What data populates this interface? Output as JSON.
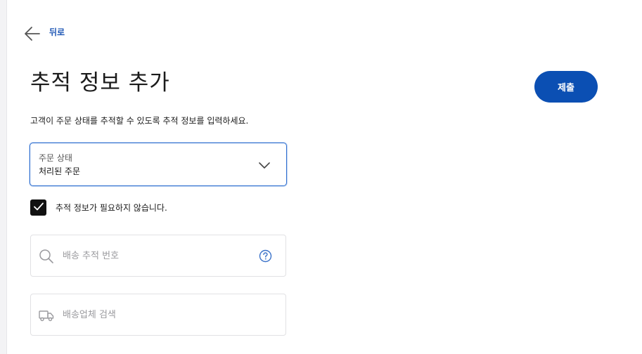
{
  "nav": {
    "back_label": "뒤로"
  },
  "header": {
    "title": "추적 정보 추가",
    "submit_label": "제출"
  },
  "form": {
    "description": "고객이 주문 상태를 추적할 수 있도록 추적 정보를 입력하세요.",
    "order_status": {
      "label": "주문 상태",
      "value": "처리된 주문"
    },
    "no_tracking_checkbox": {
      "label": "추적 정보가 필요하지 않습니다.",
      "checked": true
    },
    "tracking_number": {
      "placeholder": "배송 추적 번호",
      "value": ""
    },
    "carrier_search": {
      "placeholder": "배송업체 검색",
      "value": ""
    }
  },
  "icons": {
    "back": "arrow-left-icon",
    "dropdown": "chevron-down-icon",
    "checkbox": "checkmark-icon",
    "search": "search-icon",
    "help": "help-icon",
    "carrier": "truck-icon"
  },
  "colors": {
    "accent": "#0b4fb3",
    "link": "#1f57b5",
    "focus_border": "#2f6fd0",
    "checkbox_fill": "#111111",
    "icon_muted": "#9a9a9e"
  }
}
